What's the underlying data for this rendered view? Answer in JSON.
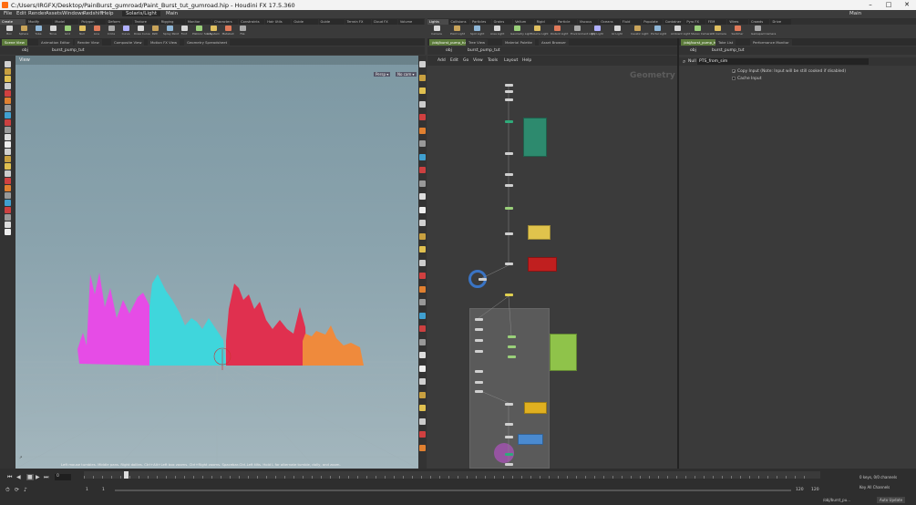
{
  "window": {
    "title": "C:/Users/IRGFX/Desktop/PainBurst_gumroad/Paint_Burst_tut_gumroad.hip - Houdini FX 17.5.360",
    "controls": [
      "–",
      "□",
      "✕"
    ]
  },
  "menubar": {
    "items": [
      "File",
      "Edit",
      "Render",
      "Assets",
      "Windows",
      "Redshift",
      "Help"
    ],
    "desktop": "Solaris/Light",
    "build": "Main",
    "right_build": "Main"
  },
  "shelf": {
    "left_tabs": [
      "Create",
      "Modify",
      "Model",
      "Polygon",
      "Deform",
      "Texture",
      "Rigging",
      "Monitor",
      "Characters",
      "Constraints",
      "Hair Utils",
      "Guide Process",
      "Guide Brushes",
      "Terrain FX",
      "Cloud FX",
      "Volume"
    ],
    "left_tools": [
      "Box",
      "Sphere",
      "Tube",
      "Torus",
      "Grid",
      "Null",
      "Line",
      "Circle",
      "Curve",
      "Draw Curve",
      "Path",
      "Spray Paint",
      "Font",
      "Platonic Solids",
      "L-System",
      "Metaball",
      "File"
    ],
    "right_tabs": [
      "Lights and Cameras",
      "Collisions",
      "Particles",
      "Grains",
      "Vellum",
      "Rigid Bodies",
      "Particle Fluids",
      "Viscous Fluids",
      "Oceans",
      "Fluid Containers",
      "Populate Containers",
      "Container Tools",
      "Pyro FX",
      "FEM",
      "Wires",
      "Crowds",
      "Drive Simulation"
    ],
    "right_tools": [
      "Camera",
      "Point Light",
      "Spot Light",
      "Area Light",
      "Geometry Light",
      "Volume Light",
      "Distant Light",
      "Environment Light",
      "Sky Light",
      "GI Light",
      "Caustic Light",
      "Portal Light",
      "Ambient Light",
      "Stereo Camera",
      "VR Camera",
      "Switcher",
      "Gamepad Camera"
    ]
  },
  "viewport": {
    "tabs": [
      "Scene View",
      "Animation Editor",
      "Render View",
      "Composite View",
      "Motion FX View",
      "Geometry Spreadsheet"
    ],
    "path": [
      "obj",
      "burst_pump_tut"
    ],
    "view_label": "View",
    "persp": "Persp ▾",
    "no_cam": "No cam ▾",
    "status": "Left mouse tumbles. Middle pans. Right dollies. Ctrl+Alt+Left box zooms. Ctrl+Right zooms. Spacebar-Ctrl-Left tilts. Hold L for alternate tumble, dolly, and zoom."
  },
  "network": {
    "tabs": [
      "/obj/burst_pump_tut",
      "Tree View",
      "Material Palette",
      "Asset Browser"
    ],
    "path": [
      "obj",
      "burst_pump_tut"
    ],
    "menu": [
      "Add",
      "Edit",
      "Go",
      "View",
      "Tools",
      "Layout",
      "Help"
    ],
    "context_label": "Geometry"
  },
  "params": {
    "tabs": [
      "/obj/burst_pump_tut",
      "Take List",
      "Performance Monitor"
    ],
    "path": [
      "obj",
      "burst_pump_tut"
    ],
    "node_type": "Null",
    "node_name": "PTS_from_sim",
    "rows": [
      {
        "label": "Copy Input (Note: Input will be still cooked if disabled)",
        "checked": true
      },
      {
        "label": "Cache Input",
        "checked": false
      }
    ]
  },
  "timeline": {
    "frame": "0",
    "start": "1",
    "end_a": "1",
    "end_b": "120",
    "end_c": "120",
    "keys_info": "0 keys, 0/0 channels",
    "key_all": "Key All Channels",
    "auto_update": "Auto Update",
    "file_label": "/obj/burst_pu..."
  },
  "colors": {
    "magenta": "#e64ce6",
    "cyan": "#3fd6dc",
    "red": "#e0304f",
    "orange": "#ef8a3c",
    "accent_green": "#5b7a3a"
  }
}
